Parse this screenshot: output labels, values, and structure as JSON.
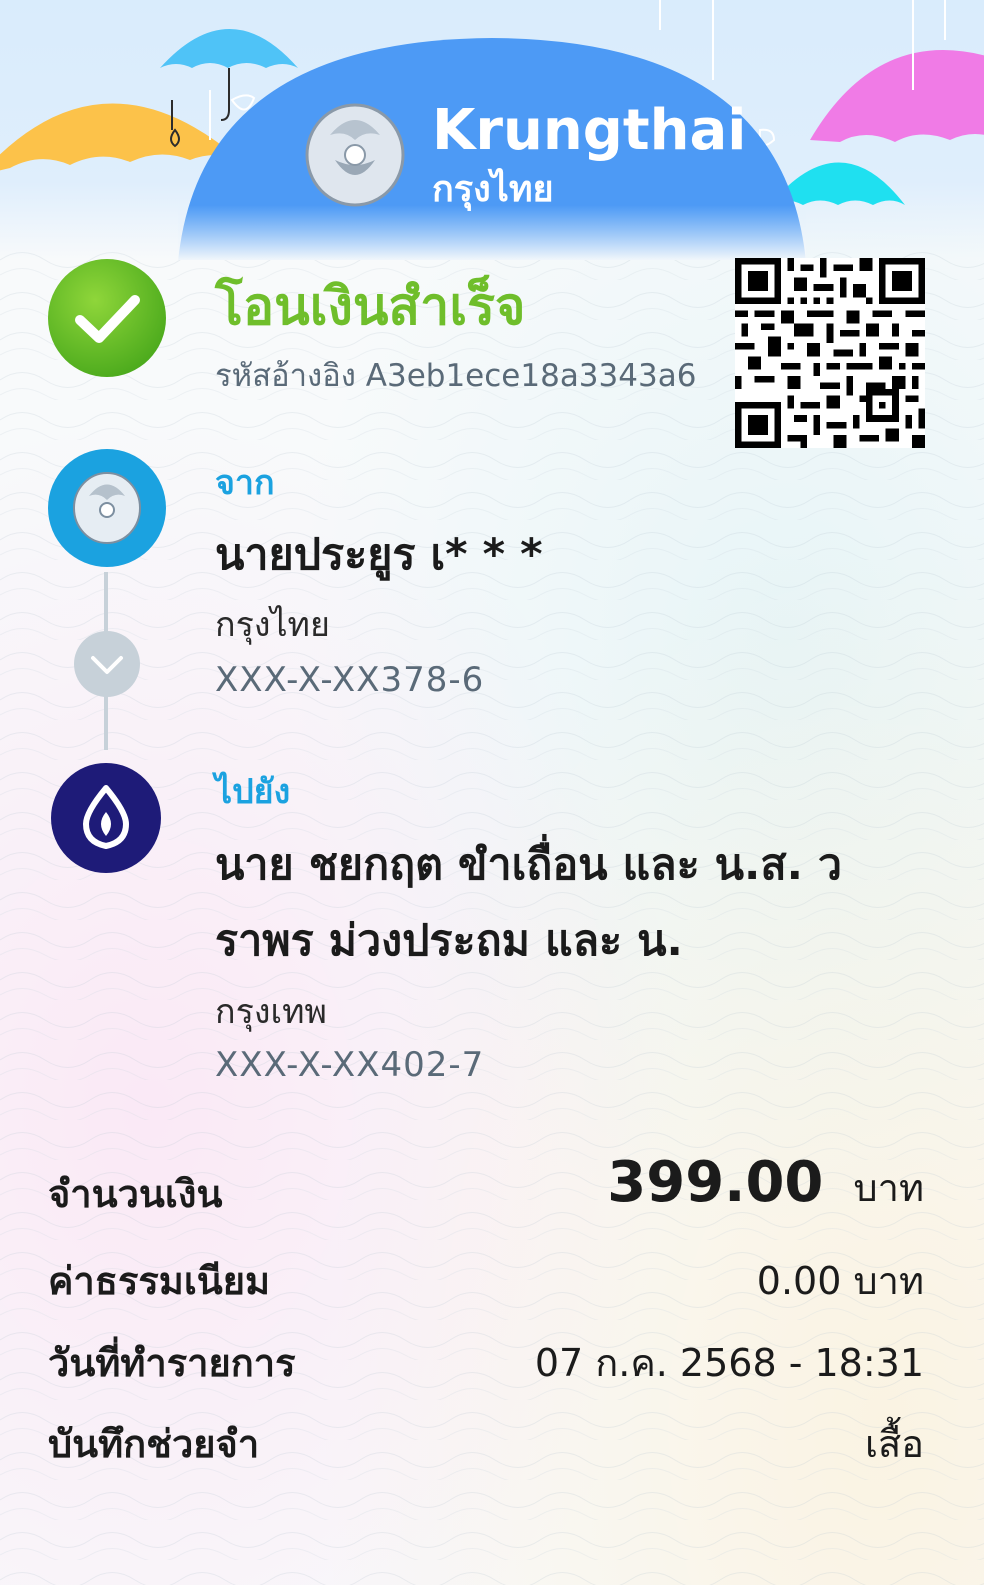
{
  "brand": {
    "name_en": "Krungthai",
    "name_th": "กรุงไทย"
  },
  "status": {
    "title": "โอนเงินสำเร็จ",
    "reference": "รหัสอ้างอิง A3eb1ece18a3343a6"
  },
  "from": {
    "label": "จาก",
    "name": "นายประยูร เ* * *",
    "bank": "กรุงไทย",
    "account": "XXX-X-XX378-6"
  },
  "to": {
    "label": "ไปยัง",
    "name_line1": "นาย ชยกฤต ขำเถื่อน และ น.ส. ว",
    "name_line2": "ราพร ม่วงประถม และ น.",
    "bank": "กรุงเทพ",
    "account": "XXX-X-XX402-7"
  },
  "details": {
    "amount_label": "จำนวนเงิน",
    "amount_value": "399.00",
    "amount_unit": "บาท",
    "fee_label": "ค่าธรรมเนียม",
    "fee_value": "0.00 บาท",
    "date_label": "วันที่ทำรายการ",
    "date_value": "07 ก.ค. 2568 - 18:31",
    "memo_label": "บันทึกช่วยจำ",
    "memo_value": "เสื้อ"
  },
  "icons": {
    "success": "check-circle-icon",
    "from_bank": "krungthai-logo-icon",
    "expand": "chevron-down-icon",
    "to_bank": "bangkok-bank-logo-icon",
    "qr": "qr-code-icon"
  },
  "colors": {
    "success_green": "#6fbe2b",
    "brand_blue": "#1ba2e0",
    "header_blue": "#4d9af5",
    "bbl_navy": "#1e1b78"
  }
}
